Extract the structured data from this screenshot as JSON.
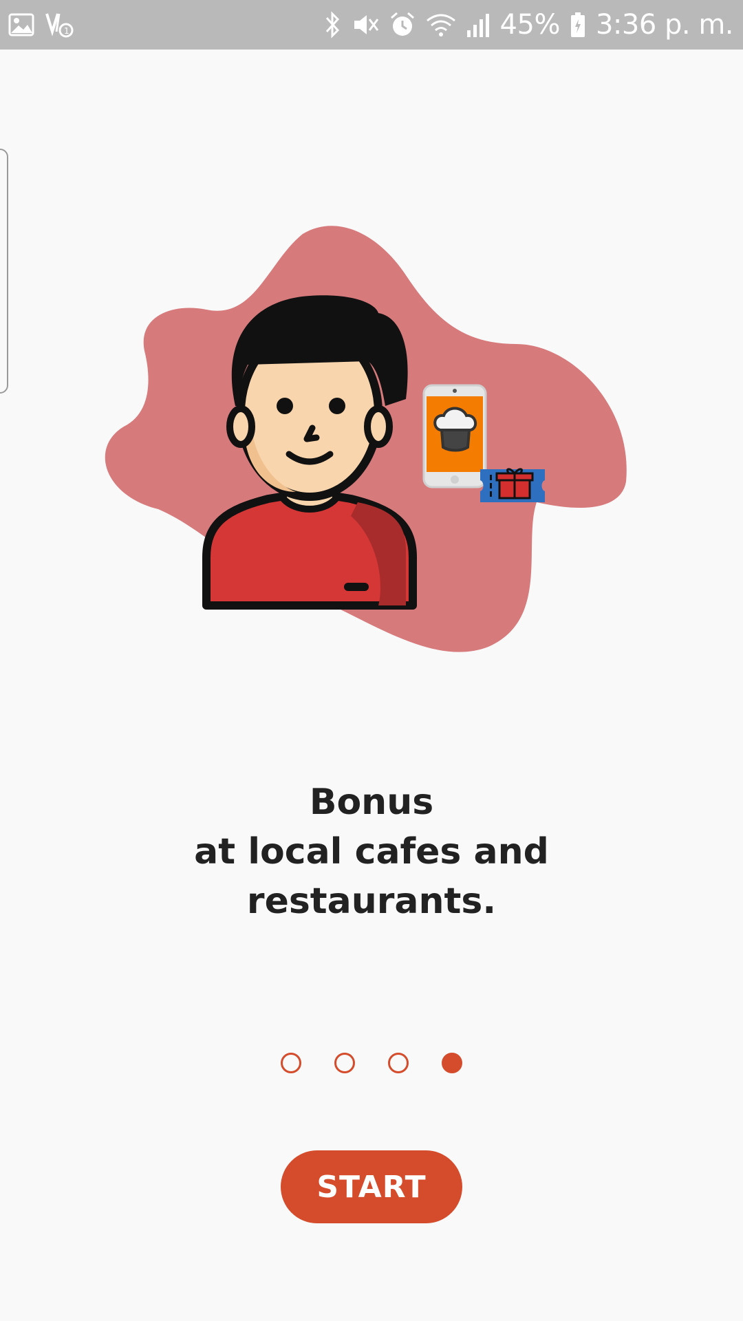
{
  "status_bar": {
    "battery": "45%",
    "time": "3:36 p. m.",
    "icons": [
      "image-icon",
      "volte-icon",
      "bluetooth-icon",
      "mute-icon",
      "alarm-icon",
      "wifi-icon",
      "signal-icon",
      "battery-icon"
    ]
  },
  "illustration": {
    "blob_color": "#d77a7c",
    "phone_screen_color": "#f47c00",
    "ticket_color": "#2e6fbf",
    "shirt_color": "#d53636"
  },
  "onboarding": {
    "title_line1": "Bonus",
    "title_line2": "at local cafes and",
    "title_line3": "restaurants."
  },
  "pager": {
    "total": 4,
    "active_index": 3
  },
  "start_button": {
    "label": "START"
  },
  "colors": {
    "accent": "#d44c2c",
    "background": "#f9f9fa",
    "text": "#222222"
  }
}
